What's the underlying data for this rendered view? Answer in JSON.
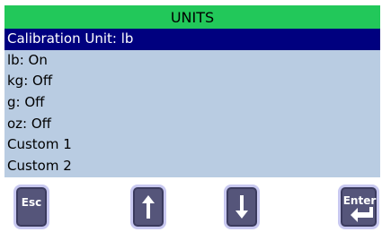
{
  "screen": {
    "title": "UNITS",
    "items": [
      {
        "label": "Calibration Unit: lb",
        "selected": true
      },
      {
        "label": "lb: On",
        "selected": false
      },
      {
        "label": "kg: Off",
        "selected": false
      },
      {
        "label": "g: Off",
        "selected": false
      },
      {
        "label": "oz: Off",
        "selected": false
      },
      {
        "label": "Custom 1",
        "selected": false
      },
      {
        "label": "Custom 2",
        "selected": false
      }
    ]
  },
  "buttons": {
    "esc_label": "Esc",
    "enter_label": "Enter",
    "up_icon": "arrow-up-icon",
    "down_icon": "arrow-down-icon",
    "enter_icon": "enter-return-icon"
  },
  "colors": {
    "title_bg": "#22c85a",
    "list_bg": "#b9cce2",
    "selected_bg": "#00007f",
    "button_bg": "#55557a"
  }
}
